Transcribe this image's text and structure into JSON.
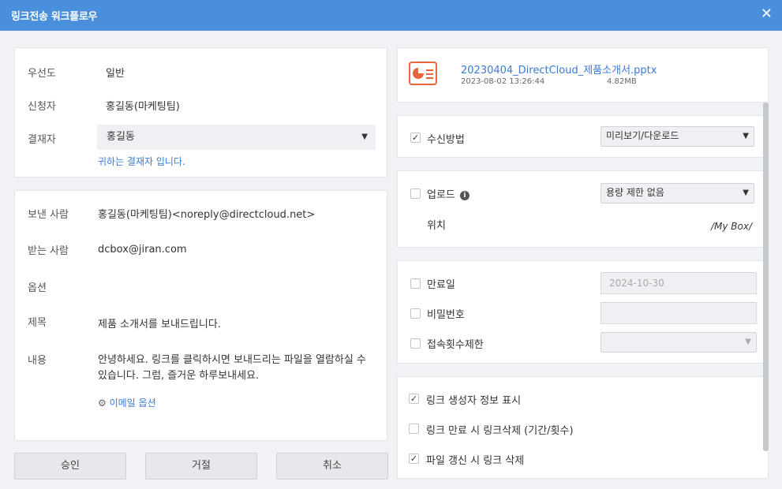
{
  "window": {
    "title": "링크전송 워크플로우",
    "close_icon": "✕"
  },
  "approval": {
    "priority_label": "우선도",
    "priority_value": "일반",
    "requester_label": "신청자",
    "requester_value": "홍길동(마케팅팀)",
    "approver_label": "결재자",
    "approver_value": "홍길동",
    "approver_note": "귀하는 결재자 입니다."
  },
  "mail": {
    "sender_label": "보낸 사람",
    "sender_value": "홍길동(마케팅팀)<noreply@directcloud.net>",
    "recipient_label": "받는 사람",
    "recipient_value": "dcbox@jiran.com",
    "options_label": "옵션",
    "subject_label": "제목",
    "subject_value": "제품 소개서를 보내드립니다.",
    "body_label": "내용",
    "body_value": "안녕하세요. 링크를 클릭하시면 보내드리는 파일을 열람하실 수 있습니다. 그럼, 즐거운 하루보내세요.",
    "email_options_link": "이메일 옵션"
  },
  "buttons": {
    "approve": "승인",
    "reject": "거절",
    "cancel": "취소"
  },
  "file": {
    "icon": "pptx-file-icon",
    "name": "20230404_DirectCloud_제품소개서.pptx",
    "date": "2023-08-02 13:26:44",
    "size": "4.82MB"
  },
  "receive": {
    "label": "수신방법",
    "checked": true,
    "method": "미리보기/다운로드"
  },
  "upload": {
    "label": "업로드",
    "checked": false,
    "limit": "용량 제한 없음",
    "location_label": "위치",
    "location_value": "/My Box/"
  },
  "expiry": {
    "label": "만료일",
    "checked": false,
    "date": "2024-10-30"
  },
  "password": {
    "label": "비밀번호",
    "checked": false
  },
  "access_limit": {
    "label": "접속횟수제한",
    "checked": false
  },
  "options": {
    "show_creator": {
      "label": "링크 생성자 정보 표시",
      "checked": true
    },
    "delete_on_expiry": {
      "label": "링크 만료 시 링크삭제 (기간/횟수)",
      "checked": false
    },
    "delete_on_update": {
      "label": "파일 갱신 시 링크 삭제",
      "checked": true
    }
  },
  "colors": {
    "titlebar": "#4a8fdb",
    "link": "#3a7bd5",
    "pptx_icon": "#e8643c"
  }
}
